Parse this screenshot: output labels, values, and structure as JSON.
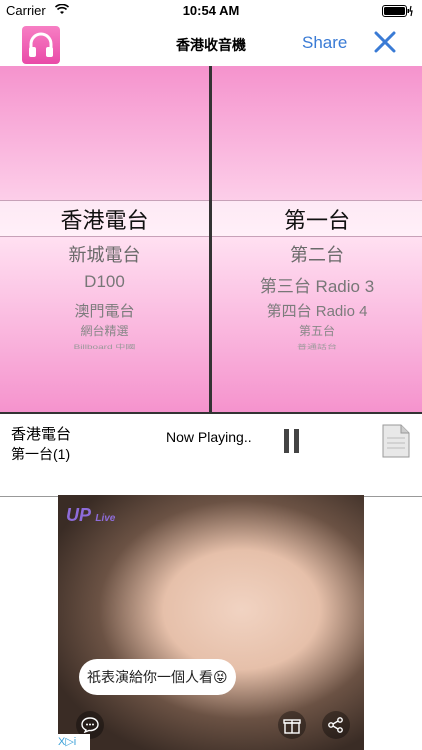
{
  "status_bar": {
    "carrier": "Carrier",
    "time": "10:54 AM"
  },
  "nav": {
    "title": "香港收音機",
    "share_label": "Share",
    "app_icon": "headphones-icon",
    "close_icon": "close-icon"
  },
  "picker_left": {
    "selected": "香港電台",
    "items": [
      "新城電台",
      "D100",
      "澳門電台",
      "網台精選",
      "Billboard 中國"
    ]
  },
  "picker_right": {
    "selected": "第一台",
    "items": [
      "第二台",
      "第三台 Radio 3",
      "第四台 Radio 4",
      "第五台",
      "普通話台"
    ]
  },
  "now_playing": {
    "station": "香港電台",
    "channel": "第一台(1)",
    "status": "Now Playing..",
    "pause_icon": "pause-icon",
    "doc_icon": "document-icon"
  },
  "ad": {
    "logo_main": "UP",
    "logo_sub": "Live",
    "bubble_text": "祇表演給你一個人看😝",
    "adchoices_label": "X▷i"
  },
  "colors": {
    "accent": "#3a7bd5",
    "picker_pink": "#f593cd",
    "picker_light": "#ffdff1"
  }
}
